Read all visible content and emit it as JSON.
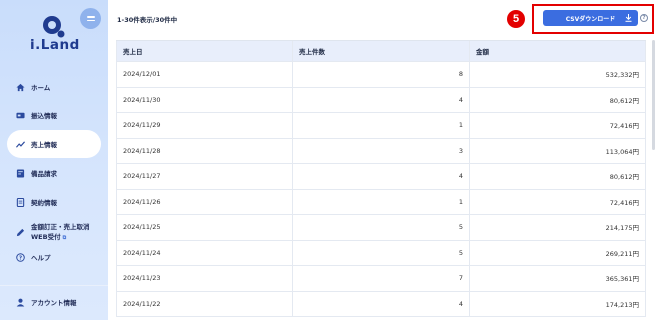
{
  "sidebar": {
    "logo_text": "i.Land",
    "items": [
      {
        "label": "ホーム",
        "icon": "home-icon"
      },
      {
        "label": "振込情報",
        "icon": "transfer-icon"
      },
      {
        "label": "売上情報",
        "icon": "chart-icon",
        "active": true
      },
      {
        "label": "備品請求",
        "icon": "invoice-icon"
      },
      {
        "label": "契約情報",
        "icon": "contract-icon"
      },
      {
        "label_line1": "金額訂正・売上取消",
        "label_line2": "WEB受付",
        "icon": "edit-icon"
      },
      {
        "label": "ヘルプ",
        "icon": "help-icon"
      },
      {
        "label": "アカウント情報",
        "icon": "user-icon"
      }
    ]
  },
  "header": {
    "count_text": "1-30件表示/30件中",
    "csv_button_label": "CSVダウンロード",
    "step_number": "5",
    "help_mark": "?"
  },
  "table": {
    "columns": [
      "売上日",
      "売上件数",
      "金額"
    ],
    "rows": [
      [
        "2024/12/01",
        "8",
        "532,332円"
      ],
      [
        "2024/11/30",
        "4",
        "80,612円"
      ],
      [
        "2024/11/29",
        "1",
        "72,416円"
      ],
      [
        "2024/11/28",
        "3",
        "113,064円"
      ],
      [
        "2024/11/27",
        "4",
        "80,612円"
      ],
      [
        "2024/11/26",
        "1",
        "72,416円"
      ],
      [
        "2024/11/25",
        "5",
        "214,175円"
      ],
      [
        "2024/11/24",
        "5",
        "269,211円"
      ],
      [
        "2024/11/23",
        "7",
        "365,361円"
      ],
      [
        "2024/11/22",
        "4",
        "174,213円"
      ]
    ]
  },
  "colors": {
    "accent": "#3b6de0",
    "highlight": "#e30000",
    "sidebar_bg": "#d3e3fc"
  }
}
